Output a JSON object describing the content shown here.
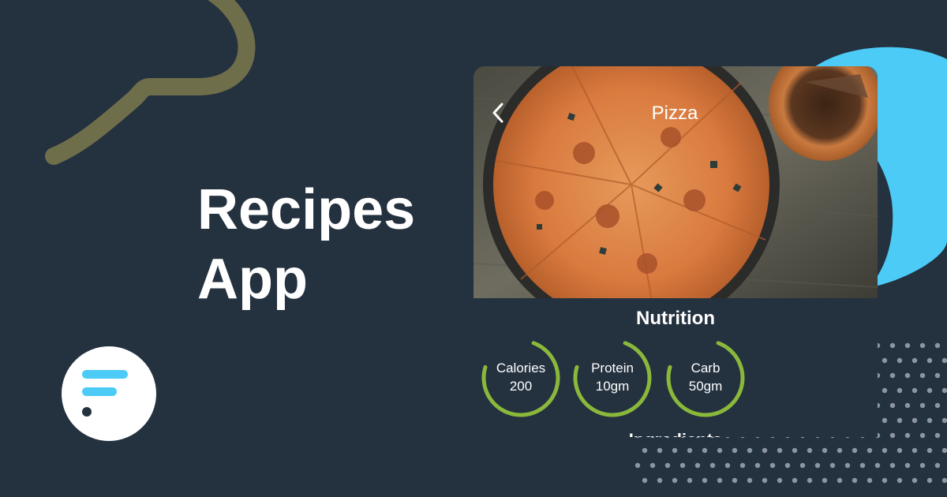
{
  "promo": {
    "headline_line1": "Recipes",
    "headline_line2": "App"
  },
  "brand": {
    "logo_icon": "brand-logo-icon",
    "accent_color": "#4ccbf7",
    "background_color": "#24313f",
    "gauge_color": "#8ab83b"
  },
  "recipe": {
    "title": "Pizza",
    "back_icon": "chevron-left-icon",
    "hero_image": "pizza-photo"
  },
  "nutrition": {
    "heading": "Nutrition",
    "items": [
      {
        "label": "Calories",
        "value": "200",
        "fill": 0.74
      },
      {
        "label": "Protein",
        "value": "10gm",
        "fill": 0.74
      },
      {
        "label": "Carb",
        "value": "50gm",
        "fill": 0.74
      }
    ]
  },
  "next_section": {
    "label": "Ingredients"
  }
}
